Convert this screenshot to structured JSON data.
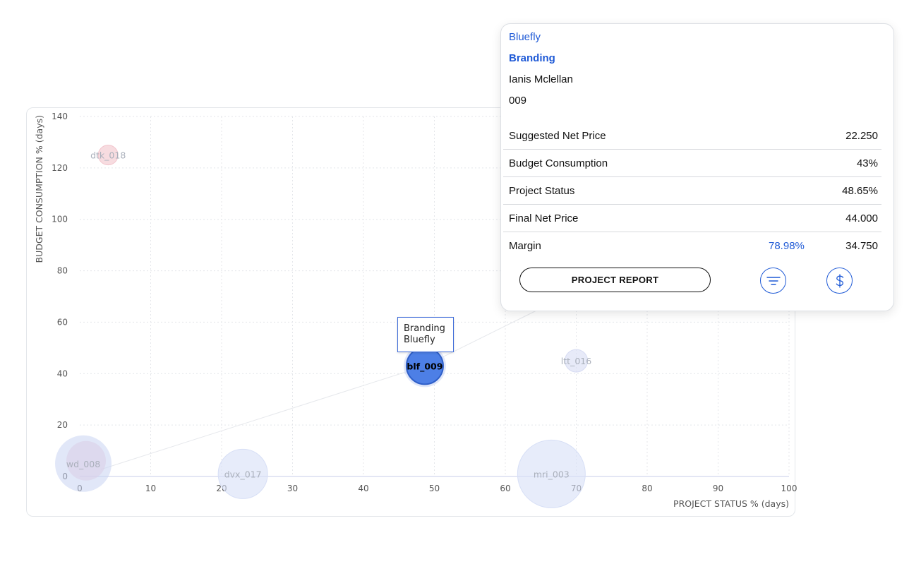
{
  "chart_data": {
    "type": "scatter",
    "xlabel": "PROJECT STATUS % (days)",
    "ylabel": "BUDGET CONSUMPTION % (days)",
    "xlim": [
      0,
      100
    ],
    "ylim": [
      0,
      140
    ],
    "x_ticks": [
      "0",
      "10",
      "20",
      "30",
      "40",
      "50",
      "60",
      "70",
      "80",
      "90",
      "100"
    ],
    "y_ticks": [
      "0",
      "20",
      "40",
      "60",
      "80",
      "100",
      "120",
      "140"
    ],
    "grid": true,
    "points": [
      {
        "label": "dtk_018",
        "x": 4,
        "y": 125,
        "color": "#f2c4cc"
      },
      {
        "label": "ltt_016",
        "x": 70,
        "y": 45,
        "color": "#d7dcf3"
      },
      {
        "label": "blf_009",
        "x": 48.65,
        "y": 43,
        "color": "#4d7fe6",
        "active": true
      },
      {
        "label": "dvx_017",
        "x": 23,
        "y": 1,
        "color": "#d7dff6"
      },
      {
        "label": "mri_003",
        "x": 66.5,
        "y": 1,
        "color": "#d7dff6"
      },
      {
        "label": "wd_008",
        "x": 0.5,
        "y": 5,
        "color": "#c8d3f2"
      }
    ]
  },
  "tooltip": {
    "line1": "Branding",
    "line2": "Bluefly"
  },
  "panel": {
    "client": "Bluefly",
    "project": "Branding",
    "manager": "Ianis Mclellan",
    "code": "009",
    "rows": [
      {
        "label": "Suggested Net Price",
        "value": "22.250"
      },
      {
        "label": "Budget Consumption",
        "value": "43%"
      },
      {
        "label": "Project Status",
        "value": "48.65%"
      },
      {
        "label": "Final Net Price",
        "value": "44.000"
      },
      {
        "label": "Margin",
        "percent": "78.98%",
        "value": "34.750"
      }
    ],
    "report_button": "PROJECT REPORT",
    "filter_icon": "filter-lines-icon",
    "money_icon": "dollar-icon"
  },
  "colors": {
    "accent": "#1f5ad6",
    "active_bubble": "#4d7fe6"
  }
}
